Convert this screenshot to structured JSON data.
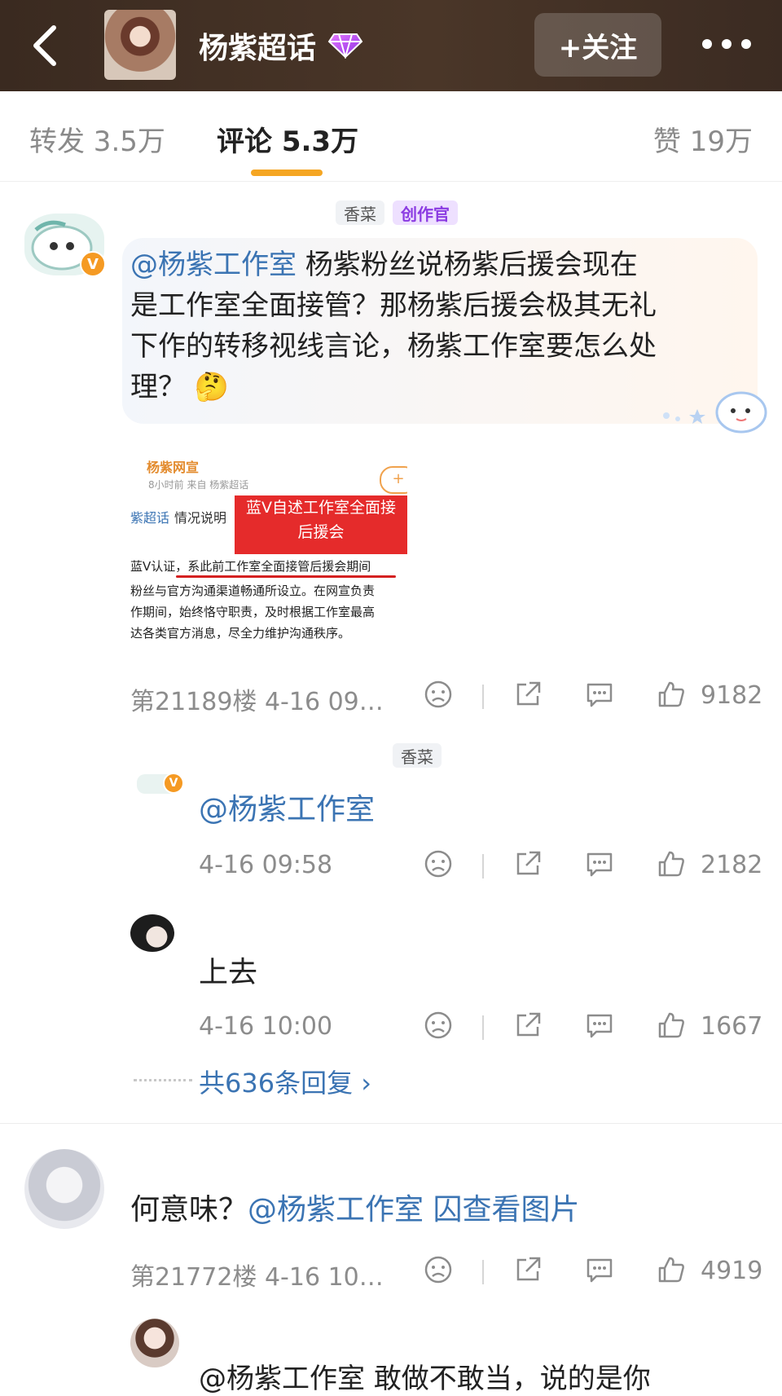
{
  "header": {
    "title": "杨紫超话",
    "follow_label": "+关注"
  },
  "tabs": {
    "repost": "转发 3.5万",
    "comment": "评论 5.3万",
    "like": "赞 19万"
  },
  "comments": [
    {
      "tag_name": "香菜",
      "tag_badge": "创作官",
      "mention": "@杨紫工作室",
      "text_line1": " 杨紫粉丝说杨紫后援会现在",
      "text_line2": "是工作室全面接管？那杨紫后援会极其无礼",
      "text_line3": "下作的转移视线言论，杨紫工作室要怎么处",
      "text_line4": "理？",
      "emoji": "🤔",
      "screenshot": {
        "name": "杨紫网宣",
        "meta": "8小时前 来自 杨紫超话",
        "topic": "紫超话",
        "topic_tail": "情况说明",
        "red_note_line1": "蓝V自述工作室全面接",
        "red_note_line2": "后援会",
        "line1": "蓝V认证，系此前工作室全面接管后援会期间",
        "line2": "粉丝与官方沟通渠道畅通所设立。在网宣负责",
        "line3": "作期间，始终恪守职责，及时根据工作室最高",
        "line4": "达各类官方消息，尽全力维护沟通秩序。"
      },
      "floor_time": "第21189楼 4-16 09…",
      "likes": "9182",
      "replies": [
        {
          "tag_name": "香菜",
          "name": "@杨紫工作室",
          "time": "4-16 09:58",
          "likes": "2182"
        },
        {
          "text": "上去",
          "time": "4-16 10:00",
          "likes": "1667"
        }
      ],
      "more_replies": "共636条回复 ›"
    },
    {
      "text_prefix": "何意味？",
      "mention": "@杨紫工作室",
      "view_image": "囚查看图片",
      "floor_time": "第21772楼 4-16 10…",
      "likes": "4919",
      "reply_preview": "@杨紫工作室 敢做不敢当，说的是你"
    }
  ]
}
